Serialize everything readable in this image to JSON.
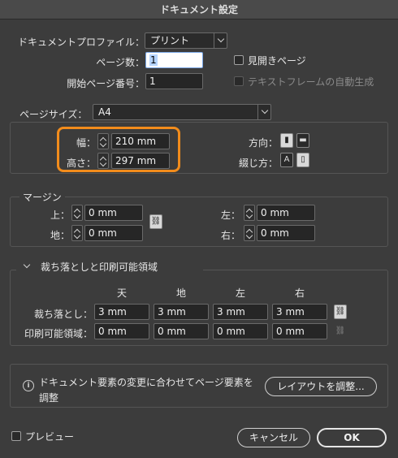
{
  "window": {
    "title": "ドキュメント設定"
  },
  "profile": {
    "label": "ドキュメントプロファイル：",
    "value": "プリント"
  },
  "pages": {
    "label": "ページ数：",
    "value": "1"
  },
  "facing": {
    "label": "見開きページ",
    "checked": false
  },
  "start_page": {
    "label": "開始ページ番号：",
    "value": "1"
  },
  "text_frame": {
    "label": "テキストフレームの自動生成",
    "checked": false,
    "disabled": true
  },
  "page_size": {
    "label": "ページサイズ：",
    "value": "A4",
    "width_label": "幅：",
    "width": "210 mm",
    "height_label": "高さ：",
    "height": "297 mm",
    "orientation_label": "方向：",
    "binding_label": "綴じ方："
  },
  "margins": {
    "title": "マージン",
    "top_label": "上：",
    "top": "0 mm",
    "bottom_label": "地：",
    "bottom": "0 mm",
    "left_label": "左：",
    "left": "0 mm",
    "right_label": "右：",
    "right": "0 mm"
  },
  "bleed_slug": {
    "title": "裁ち落としと印刷可能領域",
    "col_headers": [
      "天",
      "地",
      "左",
      "右"
    ],
    "bleed_label": "裁ち落とし：",
    "bleed": [
      "3 mm",
      "3 mm",
      "3 mm",
      "3 mm"
    ],
    "slug_label": "印刷可能領域：",
    "slug": [
      "0 mm",
      "0 mm",
      "0 mm",
      "0 mm"
    ]
  },
  "adjust": {
    "info_glyph": "i",
    "message_line1": "ドキュメント要素の変更に合わせてページ要素を",
    "message_line2": "調整",
    "button": "レイアウトを調整..."
  },
  "preview": {
    "label": "プレビュー",
    "checked": false
  },
  "buttons": {
    "cancel": "キャンセル",
    "ok": "OK"
  },
  "colors": {
    "highlight": "#f28c1c",
    "background": "#3c3c3c"
  }
}
